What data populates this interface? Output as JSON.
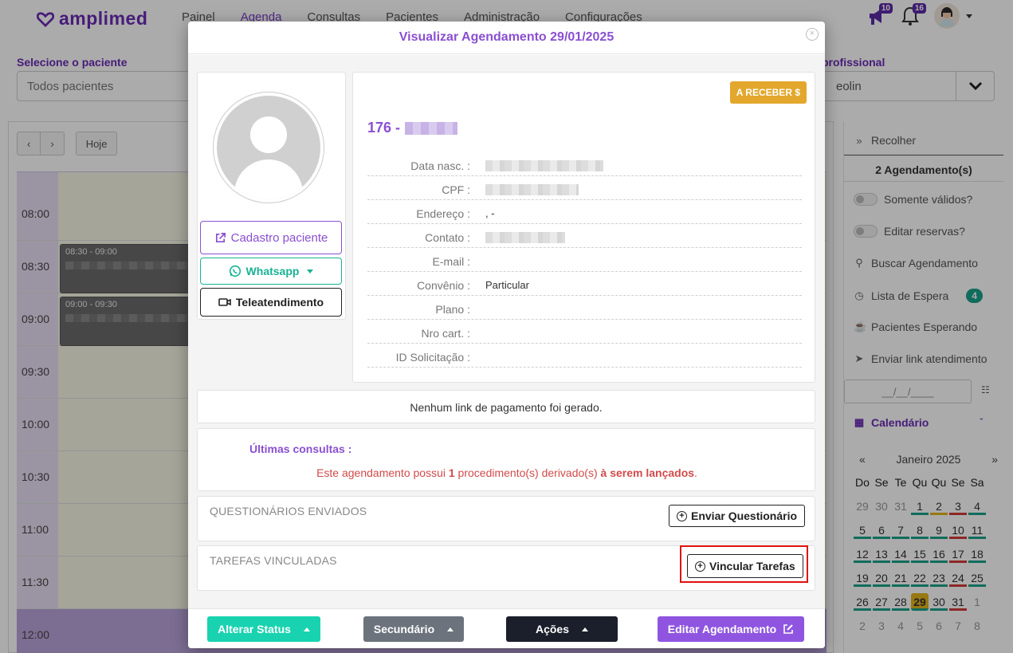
{
  "app": {
    "logo": "amplimed",
    "nav": [
      "Painel",
      "Agenda",
      "Consultas",
      "Pacientes",
      "Administração",
      "Configurações"
    ],
    "notif_badge_1": "10",
    "notif_badge_2": "16"
  },
  "filters": {
    "patient_label": "Selecione o paciente",
    "patient_value": "Todos pacientes",
    "prof_label": "profissional",
    "prof_value": "eolin"
  },
  "calendar": {
    "today_button": "Hoje",
    "times": [
      "08:00",
      "08:30",
      "09:00",
      "09:30",
      "10:00",
      "10:30",
      "11:00",
      "11:30",
      "12:00"
    ],
    "appointments": [
      {
        "time": "08:30 - 09:00"
      },
      {
        "time": "09:00 - 09:30"
      }
    ]
  },
  "sidebar": {
    "collapse": "Recolher",
    "count": "2 Agendamento(s)",
    "only_valid": "Somente válidos?",
    "edit_reservations": "Editar reservas?",
    "search": "Buscar Agendamento",
    "waitlist": "Lista de Espera",
    "waitlist_count": "4",
    "patients_waiting": "Pacientes Esperando",
    "send_link": "Enviar link atendimento",
    "date_placeholder": "__/__/____",
    "calendar_label": "Calendário",
    "month": "Janeiro 2025",
    "prev": "«",
    "next": "»",
    "dow": [
      "Do",
      "Se",
      "Te",
      "Qu",
      "Qu",
      "Se",
      "Sa"
    ],
    "days": [
      {
        "d": "29",
        "s": "muted"
      },
      {
        "d": "30",
        "s": "muted"
      },
      {
        "d": "31",
        "s": "muted"
      },
      {
        "d": "1",
        "s": "gr"
      },
      {
        "d": "2",
        "s": "yl"
      },
      {
        "d": "3",
        "s": "rd"
      },
      {
        "d": "4",
        "s": "gr"
      },
      {
        "d": "5",
        "s": "gr"
      },
      {
        "d": "6",
        "s": "gr"
      },
      {
        "d": "7",
        "s": "gr"
      },
      {
        "d": "8",
        "s": "gr"
      },
      {
        "d": "9",
        "s": "gr"
      },
      {
        "d": "10",
        "s": "rd"
      },
      {
        "d": "11",
        "s": "gr"
      },
      {
        "d": "12",
        "s": "gr"
      },
      {
        "d": "13",
        "s": "gr"
      },
      {
        "d": "14",
        "s": "gr"
      },
      {
        "d": "15",
        "s": "gr"
      },
      {
        "d": "16",
        "s": "gr"
      },
      {
        "d": "17",
        "s": "rd"
      },
      {
        "d": "18",
        "s": "gr"
      },
      {
        "d": "19",
        "s": "gr"
      },
      {
        "d": "20",
        "s": "gr"
      },
      {
        "d": "21",
        "s": "gr"
      },
      {
        "d": "22",
        "s": "gr"
      },
      {
        "d": "23",
        "s": "gr"
      },
      {
        "d": "24",
        "s": "rd"
      },
      {
        "d": "25",
        "s": "gr"
      },
      {
        "d": "26",
        "s": "gr"
      },
      {
        "d": "27",
        "s": "gr"
      },
      {
        "d": "28",
        "s": "gr"
      },
      {
        "d": "29",
        "s": "today"
      },
      {
        "d": "30",
        "s": "gr"
      },
      {
        "d": "31",
        "s": "rd"
      },
      {
        "d": "1",
        "s": "muted"
      },
      {
        "d": "2",
        "s": "muted"
      },
      {
        "d": "3",
        "s": "muted"
      },
      {
        "d": "4",
        "s": "muted"
      },
      {
        "d": "5",
        "s": "muted"
      },
      {
        "d": "6",
        "s": "muted"
      },
      {
        "d": "7",
        "s": "muted"
      },
      {
        "d": "8",
        "s": "muted"
      }
    ]
  },
  "modal": {
    "title": "Visualizar Agendamento 29/01/2025",
    "close": "×",
    "status_tag": "A RECEBER $",
    "patient_id": "176 -",
    "btn_cadastro": "Cadastro paciente",
    "btn_whatsapp": "Whatsapp",
    "btn_tele": "Teleatendimento",
    "fields": [
      {
        "label": "Data nasc. :",
        "value": ""
      },
      {
        "label": "CPF :",
        "value": ""
      },
      {
        "label": "Endereço :",
        "value": ", -"
      },
      {
        "label": "Contato :",
        "value": ""
      },
      {
        "label": "E-mail :",
        "value": ""
      },
      {
        "label": "Convênio :",
        "value": "Particular"
      },
      {
        "label": "Plano :",
        "value": ""
      },
      {
        "label": "Nro cart. :",
        "value": ""
      },
      {
        "label": "ID Solicitação :",
        "value": ""
      }
    ],
    "payment_msg": "Nenhum link de pagamento foi gerado.",
    "ultimas_title": "Últimas consultas :",
    "derived_pre": "Este agendamento possui ",
    "derived_num": "1",
    "derived_mid": " procedimento(s) derivado(s) ",
    "derived_bold": "à serem lançados",
    "derived_end": ".",
    "questionarios_title": "QUESTIONÁRIOS ENVIADOS",
    "btn_questionario": "Enviar Questionário",
    "tarefas_title": "TAREFAS VINCULADAS",
    "btn_tarefas": "Vincular Tarefas",
    "footer": {
      "alterar_status": "Alterar Status",
      "secundario": "Secundário",
      "acoes": "Ações",
      "editar": "Editar Agendamento"
    }
  },
  "colors": {
    "brand_purple": "#8a4fd1",
    "teal": "#19d3b0",
    "gray_btn": "#6c737d",
    "dark_btn": "#1a1f2b",
    "highlight_red": "#e01010",
    "tag_orange": "#e2a72c"
  }
}
